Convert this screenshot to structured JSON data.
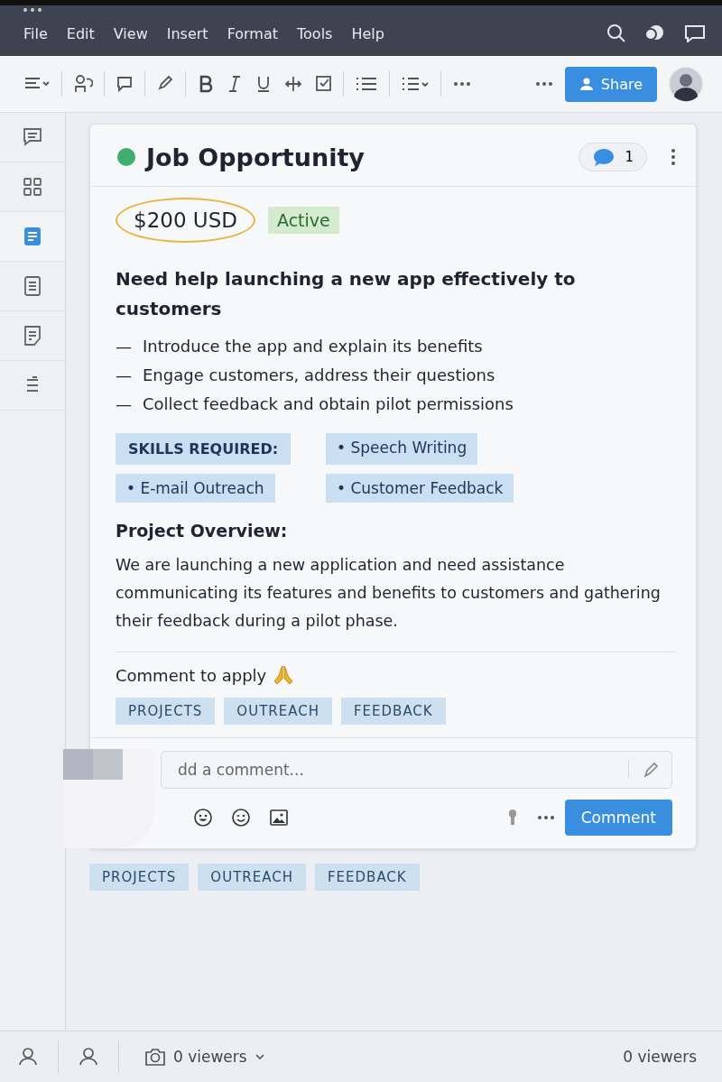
{
  "menu_bar": {
    "items": [
      "File",
      "Edit",
      "View",
      "Insert",
      "Format",
      "Tools",
      "Help"
    ]
  },
  "toolbar": {
    "share_button": "Share"
  },
  "sidebar": {
    "items": [
      {
        "selected": false
      },
      {
        "selected": false
      },
      {
        "selected": true
      },
      {
        "selected": false
      },
      {
        "selected": false
      },
      {
        "selected": false
      }
    ]
  },
  "card": {
    "title": "Job Opportunity",
    "comment_count": "1",
    "price": "$200 USD",
    "status": "Active",
    "heading": "Need help launching a new app effectively to customers",
    "bullet_marker": "—",
    "bullets": [
      "Introduce the app and explain its benefits",
      "Engage customers, address their questions",
      "Collect feedback and obtain pilot permissions"
    ],
    "skills_label": "SKILLS REQUIRED:",
    "skills": [
      "• Speech Writing",
      "• E-mail Outreach",
      "• Customer Feedback"
    ],
    "overview_title": "Project Overview:",
    "overview": "We are launching a new application and need assistance communicating its features and benefits to customers and gathering their feedback during a pilot phase.",
    "call_to_action": "Comment to apply",
    "tags": [
      "PROJECTS",
      "OUTREACH",
      "FEEDBACK"
    ],
    "comment_box": {
      "placeholder": "dd a comment...",
      "button": "Comment"
    }
  },
  "bottom_tags": [
    "PROJECTS",
    "OUTREACH",
    "FEEDBACK"
  ],
  "status_bar": {
    "viewers_menu": "0 viewers",
    "viewers": "0 viewers"
  }
}
